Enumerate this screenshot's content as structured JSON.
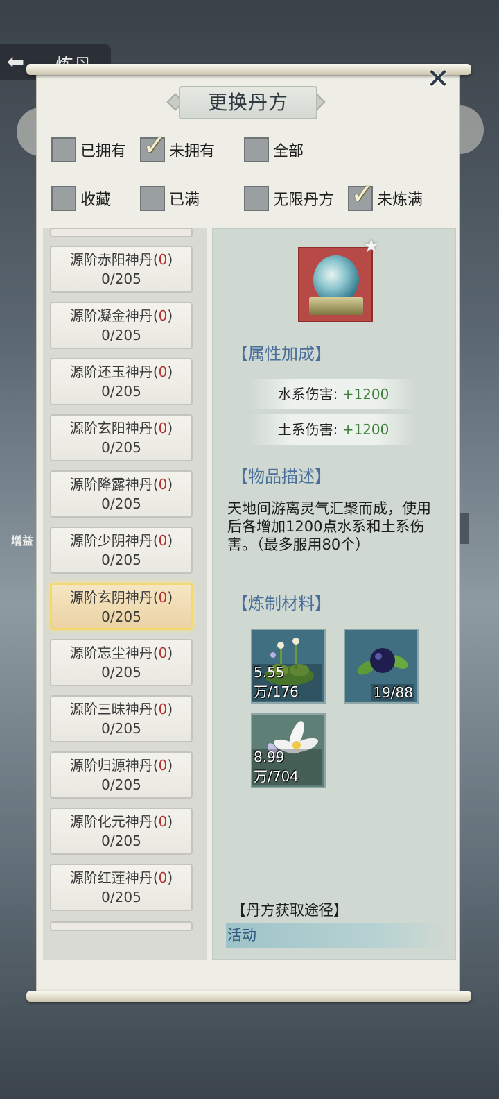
{
  "background": {
    "title": "炼丹",
    "left_label": "增益"
  },
  "dialog": {
    "title": "更换丹方",
    "close_icon": "close-icon"
  },
  "filters": [
    {
      "label": "已拥有",
      "checked": false
    },
    {
      "label": "未拥有",
      "checked": true
    },
    {
      "label": "全部",
      "checked": false
    },
    {
      "label": "收藏",
      "checked": false
    },
    {
      "label": "已满",
      "checked": false
    },
    {
      "label": "无限丹方",
      "checked": false
    },
    {
      "label": "未炼满",
      "checked": true
    }
  ],
  "recipes": [
    {
      "name": "源阶赤阳神丹",
      "count": "0",
      "progress": "0/205",
      "selected": false
    },
    {
      "name": "源阶凝金神丹",
      "count": "0",
      "progress": "0/205",
      "selected": false
    },
    {
      "name": "源阶还玉神丹",
      "count": "0",
      "progress": "0/205",
      "selected": false
    },
    {
      "name": "源阶玄阳神丹",
      "count": "0",
      "progress": "0/205",
      "selected": false
    },
    {
      "name": "源阶降露神丹",
      "count": "0",
      "progress": "0/205",
      "selected": false
    },
    {
      "name": "源阶少阴神丹",
      "count": "0",
      "progress": "0/205",
      "selected": false
    },
    {
      "name": "源阶玄阴神丹",
      "count": "0",
      "progress": "0/205",
      "selected": true
    },
    {
      "name": "源阶忘尘神丹",
      "count": "0",
      "progress": "0/205",
      "selected": false
    },
    {
      "name": "源阶三昧神丹",
      "count": "0",
      "progress": "0/205",
      "selected": false
    },
    {
      "name": "源阶归源神丹",
      "count": "0",
      "progress": "0/205",
      "selected": false
    },
    {
      "name": "源阶化元神丹",
      "count": "0",
      "progress": "0/205",
      "selected": false
    },
    {
      "name": "源阶红莲神丹",
      "count": "0",
      "progress": "0/205",
      "selected": false
    }
  ],
  "detail": {
    "attr_title": "【属性加成】",
    "attributes": [
      {
        "label": "水系伤害:",
        "value": "+1200"
      },
      {
        "label": "土系伤害:",
        "value": "+1200"
      }
    ],
    "desc_title": "【物品描述】",
    "description": "天地间游离灵气汇聚而成，使用后各增加1200点水系和土系伤害。（最多服用80个）",
    "materials_title": "【炼制材料】",
    "materials": [
      {
        "icon": "herb-plant-icon",
        "quantity": "5.55万/176"
      },
      {
        "icon": "dark-berry-icon",
        "quantity": "19/88"
      },
      {
        "icon": "white-lily-icon",
        "quantity": "8.99万/704"
      }
    ],
    "source_title": "【丹方获取途径】",
    "source": "活动"
  }
}
